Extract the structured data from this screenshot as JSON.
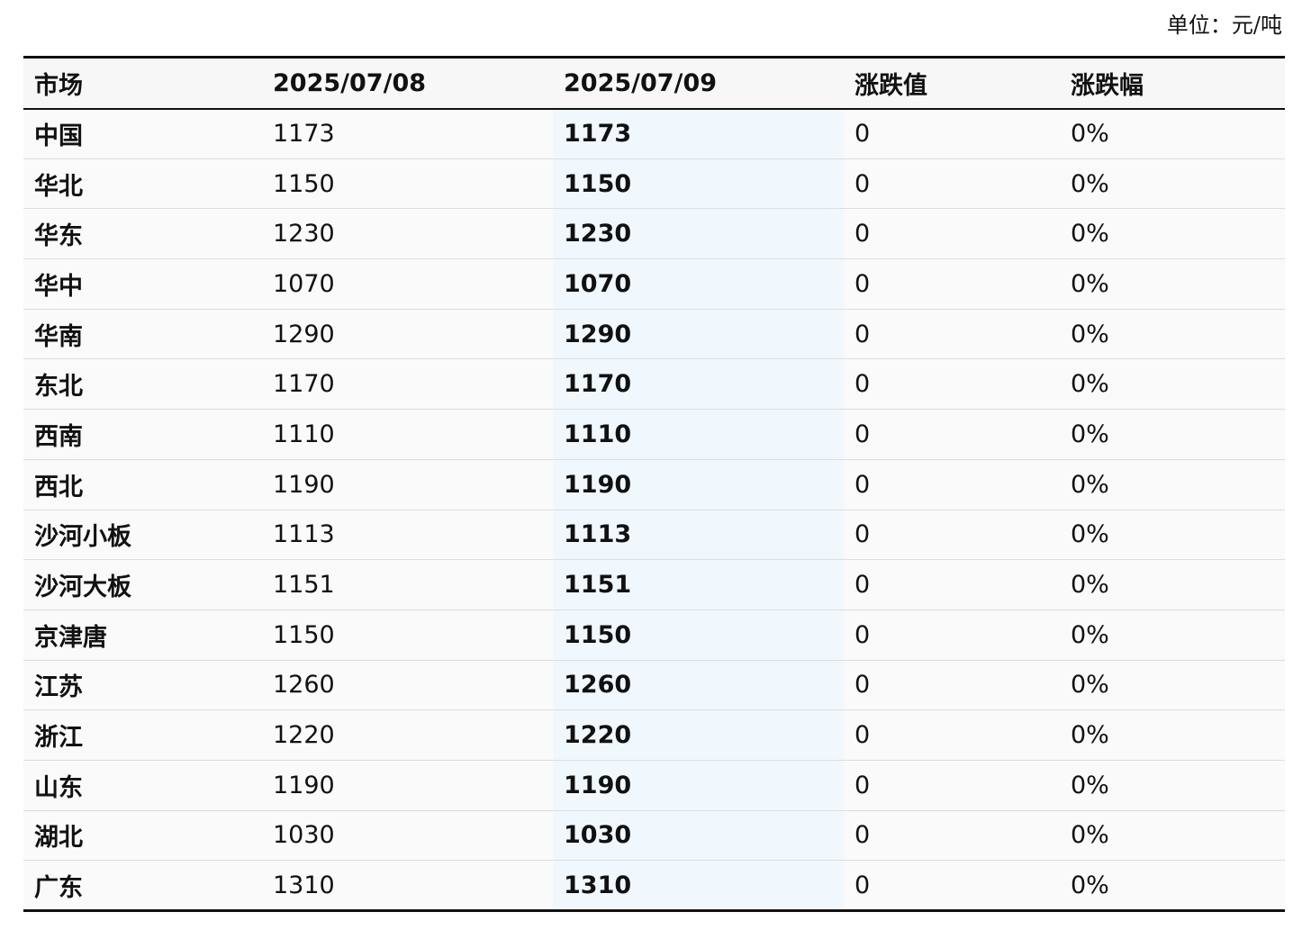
{
  "unit_label": "单位：元/吨",
  "table": {
    "headers": [
      "市场",
      "2025/07/08",
      "2025/07/09",
      "涨跌值",
      "涨跌幅"
    ],
    "rows": [
      {
        "market": "中国",
        "d1": "1173",
        "d2": "1173",
        "chg": "0",
        "pct": "0%"
      },
      {
        "market": "华北",
        "d1": "1150",
        "d2": "1150",
        "chg": "0",
        "pct": "0%"
      },
      {
        "market": "华东",
        "d1": "1230",
        "d2": "1230",
        "chg": "0",
        "pct": "0%"
      },
      {
        "market": "华中",
        "d1": "1070",
        "d2": "1070",
        "chg": "0",
        "pct": "0%"
      },
      {
        "market": "华南",
        "d1": "1290",
        "d2": "1290",
        "chg": "0",
        "pct": "0%"
      },
      {
        "market": "东北",
        "d1": "1170",
        "d2": "1170",
        "chg": "0",
        "pct": "0%"
      },
      {
        "market": "西南",
        "d1": "1110",
        "d2": "1110",
        "chg": "0",
        "pct": "0%"
      },
      {
        "market": "西北",
        "d1": "1190",
        "d2": "1190",
        "chg": "0",
        "pct": "0%"
      },
      {
        "market": "沙河小板",
        "d1": "1113",
        "d2": "1113",
        "chg": "0",
        "pct": "0%"
      },
      {
        "market": "沙河大板",
        "d1": "1151",
        "d2": "1151",
        "chg": "0",
        "pct": "0%"
      },
      {
        "market": "京津唐",
        "d1": "1150",
        "d2": "1150",
        "chg": "0",
        "pct": "0%"
      },
      {
        "market": "江苏",
        "d1": "1260",
        "d2": "1260",
        "chg": "0",
        "pct": "0%"
      },
      {
        "market": "浙江",
        "d1": "1220",
        "d2": "1220",
        "chg": "0",
        "pct": "0%"
      },
      {
        "market": "山东",
        "d1": "1190",
        "d2": "1190",
        "chg": "0",
        "pct": "0%"
      },
      {
        "market": "湖北",
        "d1": "1030",
        "d2": "1030",
        "chg": "0",
        "pct": "0%"
      },
      {
        "market": "广东",
        "d1": "1310",
        "d2": "1310",
        "chg": "0",
        "pct": "0%"
      }
    ]
  }
}
